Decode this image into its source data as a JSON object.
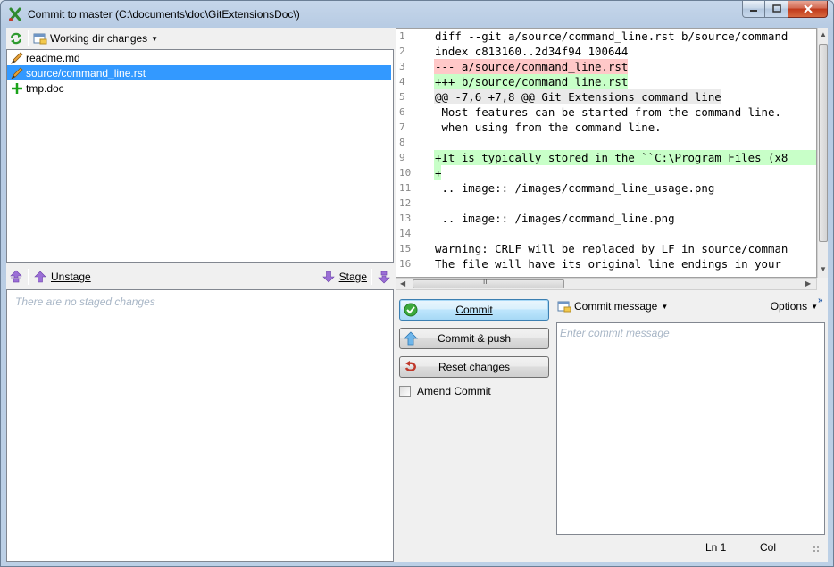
{
  "window": {
    "title": "Commit to master (C:\\documents\\doc\\GitExtensionsDoc\\)"
  },
  "unstaged": {
    "dropdown_label": "Working dir changes",
    "files": [
      {
        "name": "readme.md",
        "status_icon": "pencil-icon",
        "selected": false
      },
      {
        "name": "source/command_line.rst",
        "status_icon": "pencil-icon",
        "selected": true
      },
      {
        "name": "tmp.doc",
        "status_icon": "plus-icon",
        "selected": false
      }
    ]
  },
  "staging": {
    "unstage_label": "Unstage",
    "stage_label": "Stage",
    "empty_hint": "There are no staged changes"
  },
  "diff": {
    "line_numbers": [
      "1",
      "2",
      "3",
      "4",
      "5",
      "6",
      "7",
      "8",
      "9",
      "10",
      "11",
      "12",
      "13",
      "14",
      "15",
      "16"
    ],
    "lines": [
      {
        "text": "diff --git a/source/command_line.rst b/source/command",
        "kind": "plain"
      },
      {
        "text": "index c813160..2d34f94 100644",
        "kind": "plain"
      },
      {
        "text": "--- a/source/command_line.rst",
        "kind": "removed"
      },
      {
        "text": "+++ b/source/command_line.rst",
        "kind": "added-inline"
      },
      {
        "text": "@@ -7,6 +7,8 @@ Git Extensions command line",
        "kind": "header"
      },
      {
        "text": " Most features can be started from the command line.",
        "kind": "plain"
      },
      {
        "text": " when using from the command line.",
        "kind": "plain"
      },
      {
        "text": "",
        "kind": "plain"
      },
      {
        "text": "+It is typically stored in the ``C:\\Program Files (x8",
        "kind": "added"
      },
      {
        "text": "+",
        "kind": "added-inline"
      },
      {
        "text": " .. image:: /images/command_line_usage.png",
        "kind": "plain"
      },
      {
        "text": "",
        "kind": "plain"
      },
      {
        "text": " .. image:: /images/command_line.png",
        "kind": "plain"
      },
      {
        "text": "",
        "kind": "plain"
      },
      {
        "text": "warning: CRLF will be replaced by LF in source/comman",
        "kind": "plain"
      },
      {
        "text": "The file will have its original line endings in your",
        "kind": "plain"
      }
    ],
    "hscroll_grip": "III"
  },
  "commit": {
    "commit_label": "Commit",
    "commit_push_label": "Commit & push",
    "reset_label": "Reset changes",
    "amend_label": "Amend Commit",
    "amend_checked": false,
    "message_dropdown_label": "Commit message",
    "options_label": "Options",
    "message_placeholder": "Enter commit message",
    "status_ln": "Ln 1",
    "status_col": "Col"
  }
}
